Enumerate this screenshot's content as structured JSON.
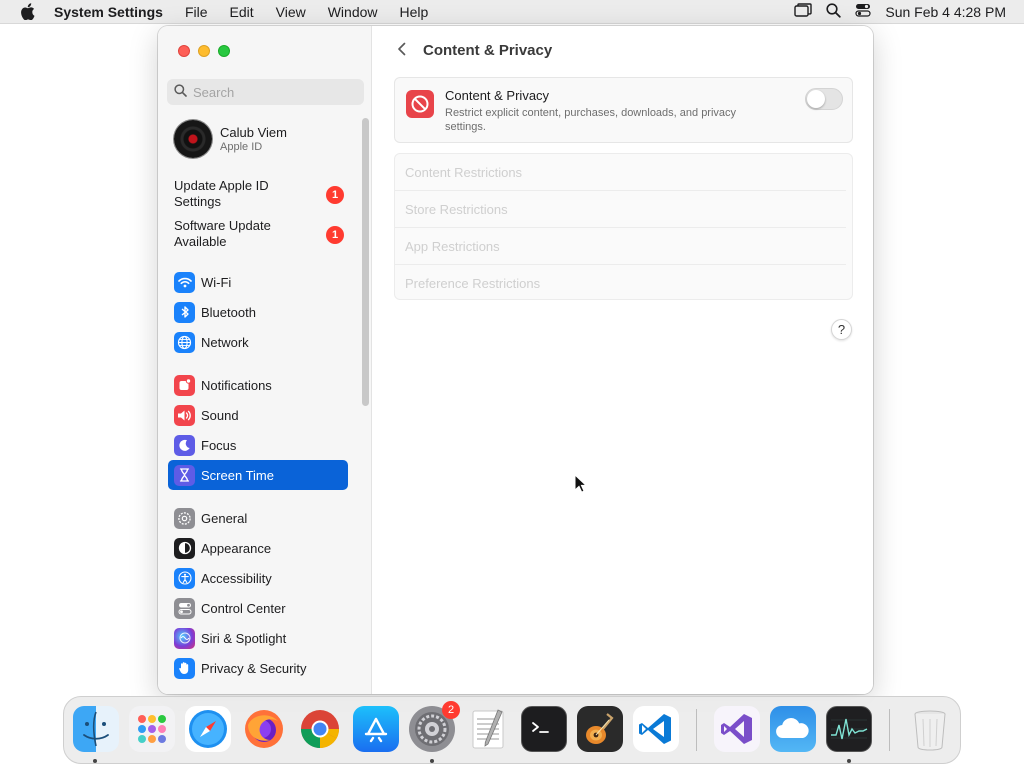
{
  "menubar": {
    "app_name": "System Settings",
    "items": [
      "File",
      "Edit",
      "View",
      "Window",
      "Help"
    ],
    "clock": "Sun Feb 4  4:28 PM"
  },
  "sidebar": {
    "search_placeholder": "Search",
    "account": {
      "name": "Calub Viem",
      "subtitle": "Apple ID"
    },
    "alerts": [
      {
        "label": "Update Apple ID Settings",
        "badge": "1"
      },
      {
        "label": "Software Update Available",
        "badge": "1"
      }
    ],
    "items": [
      {
        "label": "Wi-Fi",
        "icon": "wifi-icon",
        "color": "#1a82fb"
      },
      {
        "label": "Bluetooth",
        "icon": "bluetooth-icon",
        "color": "#1a82fb"
      },
      {
        "label": "Network",
        "icon": "globe-icon",
        "color": "#1a82fb"
      },
      {
        "label": "Notifications",
        "icon": "bell-icon",
        "color": "#f2454c"
      },
      {
        "label": "Sound",
        "icon": "speaker-icon",
        "color": "#f2454c"
      },
      {
        "label": "Focus",
        "icon": "moon-icon",
        "color": "#5e5ce6"
      },
      {
        "label": "Screen Time",
        "icon": "hourglass-icon",
        "color": "#5e5ce6"
      },
      {
        "label": "General",
        "icon": "gear-icon",
        "color": "#8e8e93"
      },
      {
        "label": "Appearance",
        "icon": "appearance-icon",
        "color": "#1d1d1f"
      },
      {
        "label": "Accessibility",
        "icon": "accessibility-icon",
        "color": "#1a82fb"
      },
      {
        "label": "Control Center",
        "icon": "control-center-icon",
        "color": "#8e8e93"
      },
      {
        "label": "Siri & Spotlight",
        "icon": "siri-icon",
        "color": "#c63fd6"
      },
      {
        "label": "Privacy & Security",
        "icon": "hand-icon",
        "color": "#1a82fb"
      }
    ],
    "active_item": "Screen Time"
  },
  "content": {
    "title": "Content & Privacy",
    "main_card": {
      "title": "Content & Privacy",
      "description": "Restrict explicit content, purchases, downloads, and privacy settings.",
      "toggle_on": false
    },
    "restrictions": [
      "Content Restrictions",
      "Store Restrictions",
      "App Restrictions",
      "Preference Restrictions"
    ],
    "help_label": "?"
  },
  "dock": {
    "apps": [
      {
        "name": "Finder",
        "icon": "finder-icon",
        "running": true
      },
      {
        "name": "Launchpad",
        "icon": "launchpad-icon",
        "running": false
      },
      {
        "name": "Safari",
        "icon": "safari-icon",
        "running": false
      },
      {
        "name": "Firefox",
        "icon": "firefox-icon",
        "running": false
      },
      {
        "name": "Chrome",
        "icon": "chrome-icon",
        "running": false
      },
      {
        "name": "App Store",
        "icon": "app-store-icon",
        "running": false
      },
      {
        "name": "System Settings",
        "icon": "system-settings-icon",
        "running": true,
        "badge": "2"
      },
      {
        "name": "TextEdit",
        "icon": "textedit-icon",
        "running": false
      },
      {
        "name": "Terminal",
        "icon": "terminal-icon",
        "running": false
      },
      {
        "name": "GarageBand",
        "icon": "garageband-icon",
        "running": false
      },
      {
        "name": "VS Code",
        "icon": "vscode-icon",
        "running": false
      },
      {
        "name": "Visual Studio",
        "icon": "visual-studio-icon",
        "running": false
      },
      {
        "name": "iCloud",
        "icon": "icloud-icon",
        "running": false
      },
      {
        "name": "Activity Monitor",
        "icon": "activity-monitor-icon",
        "running": true
      },
      {
        "name": "Trash",
        "icon": "trash-icon",
        "running": false
      }
    ]
  }
}
